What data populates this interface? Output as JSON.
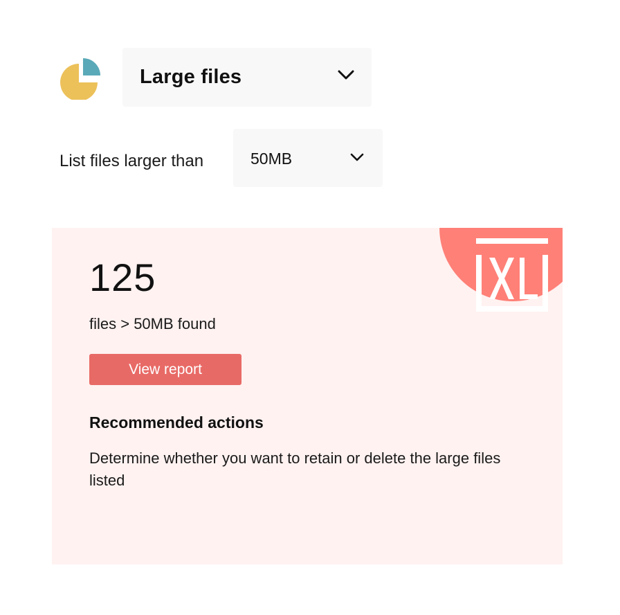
{
  "header": {
    "icon": "pie-chart-icon",
    "report_type": "Large files",
    "dropdown_icon": "chevron-down-icon"
  },
  "threshold": {
    "label": "List files larger than",
    "selected_size": "50MB",
    "dropdown_icon": "chevron-down-icon"
  },
  "result": {
    "badge_icon": "xl-file-icon",
    "count": "125",
    "description": "files > 50MB found",
    "view_report_label": "View report",
    "recommended_title": "Recommended actions",
    "recommended_text": "Determine whether you want to retain or delete the large files listed"
  },
  "colors": {
    "pie_primary": "#ecc15a",
    "pie_secondary": "#5aa9b8",
    "card_background": "#fff2f1",
    "badge": "#ff8077",
    "button": "#e86a66",
    "select_background": "#f8f8f8"
  }
}
